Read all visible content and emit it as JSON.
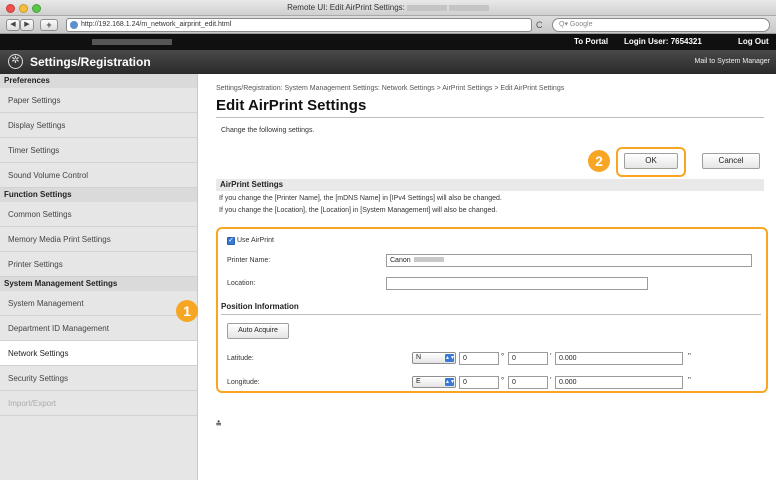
{
  "browser": {
    "window_title": "Remote UI: Edit AirPrint Settings:",
    "url": "http://192.168.1.24/m_network_airprint_edit.html",
    "search_placeholder": "Google",
    "back_glyph": "◀",
    "forward_glyph": "▶",
    "add_glyph": "+",
    "reload_glyph": "C",
    "search_glyph": "Q▾"
  },
  "header": {
    "portal_label": "To Portal",
    "login_label": "Login User:",
    "login_user": "7654321",
    "logout_label": "Log Out",
    "app_title": "Settings/Registration",
    "mail_label": "Mail to System Manager",
    "settings_icon_glyph": "✲"
  },
  "sidebar": {
    "groups": [
      {
        "heading": "Preferences",
        "items": [
          "Paper Settings",
          "Display Settings",
          "Timer Settings",
          "Sound Volume Control"
        ]
      },
      {
        "heading": "Function Settings",
        "items": [
          "Common Settings",
          "Memory Media Print Settings",
          "Printer Settings"
        ]
      },
      {
        "heading": "System Management Settings",
        "items": [
          "System Management",
          "Department ID Management",
          "Network Settings",
          "Security Settings",
          "Import/Export"
        ]
      }
    ]
  },
  "main": {
    "breadcrumb": "Settings/Registration: System Management Settings: Network Settings > AirPrint Settings > Edit AirPrint Settings",
    "title": "Edit AirPrint Settings",
    "instruction": "Change the following settings.",
    "ok_label": "OK",
    "cancel_label": "Cancel",
    "section_title": "AirPrint Settings",
    "notes": [
      "If you change the [Printer Name], the [mDNS Name] in [IPv4 Settings] will also be changed.",
      "If you change the [Location], the [Location] in [System Management] will also be changed."
    ],
    "use_airprint_label": "Use AirPrint",
    "use_airprint_checked": true,
    "check_glyph": "✓",
    "printer_name_label": "Printer Name:",
    "printer_name_value": "Canon",
    "location_label": "Location:",
    "location_value": "",
    "position_title": "Position Information",
    "auto_acquire_label": "Auto Acquire",
    "latitude_label": "Latitude:",
    "latitude_dir": "N",
    "latitude_deg": "0",
    "latitude_min": "0",
    "latitude_sec": "0.000",
    "longitude_label": "Longitude:",
    "longitude_dir": "E",
    "longitude_deg": "0",
    "longitude_min": "0",
    "longitude_sec": "0.000",
    "degree_sign": "°",
    "minute_sign": "'",
    "second_sign": "\"",
    "top_link_glyph": "⩮"
  },
  "annotations": {
    "badge1": "1",
    "badge2": "2",
    "highlight_color": "#f6a623"
  }
}
